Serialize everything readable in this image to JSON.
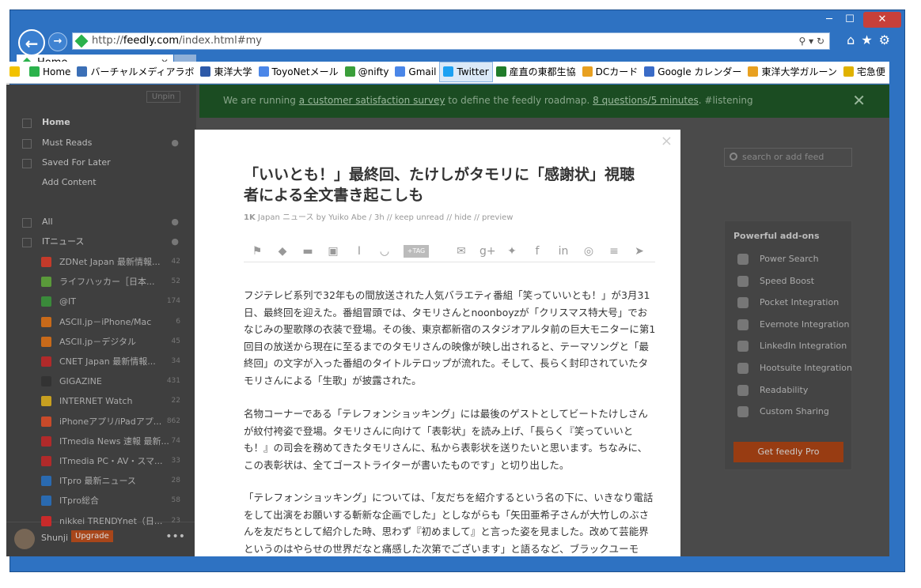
{
  "window": {
    "min": "─",
    "max": "☐",
    "close": "✕"
  },
  "nav": {
    "url_prefix": "http://",
    "url_domain": "feedly.com",
    "url_path": "/index.html#my",
    "addr_tools": "⚲ ▾ ↻",
    "toolbar_icons": "⌂★⚙"
  },
  "tab": {
    "label": "Home",
    "close": "✕"
  },
  "favorites": [
    {
      "label": "",
      "icon": "star-add-icon",
      "color": "#f2c200"
    },
    {
      "label": "Home",
      "icon": "feedly-icon",
      "color": "#2bb24c"
    },
    {
      "label": "バーチャルメディアラボ",
      "icon": "vml-icon",
      "color": "#3b6fb6"
    },
    {
      "label": "東洋大学",
      "icon": "toyo-icon",
      "color": "#2e5aa8"
    },
    {
      "label": "ToyoNetメール",
      "icon": "google-icon",
      "color": "#4a86e8"
    },
    {
      "label": "@nifty",
      "icon": "nifty-icon",
      "color": "#3a9e3a"
    },
    {
      "label": "Gmail",
      "icon": "google-icon",
      "color": "#4a86e8"
    },
    {
      "label": "Twitter",
      "icon": "twitter-icon",
      "color": "#1da1f2"
    },
    {
      "label": "産直の東都生協",
      "icon": "coop-icon",
      "color": "#207c2a"
    },
    {
      "label": "DCカード",
      "icon": "ie-icon",
      "color": "#e8a020"
    },
    {
      "label": "Google カレンダー",
      "icon": "calendar-icon",
      "color": "#3a6bc7"
    },
    {
      "label": "東洋大学ガルーン",
      "icon": "ie-icon",
      "color": "#e8a020"
    },
    {
      "label": "宅急便",
      "icon": "yamato-icon",
      "color": "#e0b200"
    }
  ],
  "sidebar": {
    "unpin": "Unpin",
    "nav": [
      {
        "label": "Home",
        "bold": true,
        "extra": ""
      },
      {
        "label": "Must Reads",
        "bold": false,
        "extra": "●"
      },
      {
        "label": "Saved For Later",
        "bold": false,
        "extra": ""
      },
      {
        "label": "Add Content",
        "bold": false,
        "extra": ""
      },
      {
        "label": "All",
        "bold": false,
        "extra": "●"
      },
      {
        "label": "ITニュース",
        "bold": false,
        "extra": "●"
      }
    ],
    "feeds": [
      {
        "label": "ZDNet Japan 最新情報...",
        "count": "42",
        "color": "#c43a2a"
      },
      {
        "label": "ライフハッカー［日本...",
        "count": "52",
        "color": "#5a9a3a"
      },
      {
        "label": "@IT",
        "count": "174",
        "color": "#3a8a3a"
      },
      {
        "label": "ASCII.jp－iPhone/Mac",
        "count": "6",
        "color": "#c86a1a"
      },
      {
        "label": "ASCII.jp－デジタル",
        "count": "45",
        "color": "#c86a1a"
      },
      {
        "label": "CNET Japan 最新情報...",
        "count": "34",
        "color": "#b02a2a"
      },
      {
        "label": "GIGAZINE",
        "count": "431",
        "color": "#333333"
      },
      {
        "label": "INTERNET Watch",
        "count": "22",
        "color": "#c8a020"
      },
      {
        "label": "iPhoneアプリ/iPadアプ...",
        "count": "862",
        "color": "#c84a2a"
      },
      {
        "label": "ITmedia News 速報 最新...",
        "count": "74",
        "color": "#b02a2a"
      },
      {
        "label": "ITmedia PC・AV・スマ...",
        "count": "33",
        "color": "#b02a2a"
      },
      {
        "label": "ITpro 最新ニュース",
        "count": "28",
        "color": "#2a6ab0"
      },
      {
        "label": "ITpro総合",
        "count": "58",
        "color": "#2a6ab0"
      },
      {
        "label": "nikkei TRENDYnet（日...",
        "count": "23",
        "color": "#c82a2a"
      }
    ],
    "user": {
      "name": "Shunji",
      "upgrade": "Upgrade",
      "more": "•••"
    }
  },
  "banner": {
    "pre": "We are running ",
    "link1": "a customer satisfaction survey",
    "mid": " to define the feedly roadmap. ",
    "link2": "8 questions/5 minutes",
    "post": ". #listening",
    "close": "✕"
  },
  "search": {
    "placeholder": "search or add feed"
  },
  "addons": {
    "header": "Powerful add-ons",
    "items": [
      {
        "label": "Power Search",
        "icon": "search-icon"
      },
      {
        "label": "Speed Boost",
        "icon": "rocket-icon"
      },
      {
        "label": "Pocket Integration",
        "icon": "pocket-icon"
      },
      {
        "label": "Evernote Integration",
        "icon": "evernote-icon"
      },
      {
        "label": "LinkedIn Integration",
        "icon": "linkedin-icon"
      },
      {
        "label": "Hootsuite Integration",
        "icon": "hootsuite-icon"
      },
      {
        "label": "Readability",
        "icon": "readability-icon"
      },
      {
        "label": "Custom Sharing",
        "icon": "send-icon"
      }
    ],
    "pro_button": "Get feedly Pro"
  },
  "article": {
    "close": "×",
    "title": "「いいとも！」最終回、たけしがタモリに「感謝状」視聴者による全文書き起こしも",
    "meta_count": "1K",
    "meta_rest": "Japan ニュース by Yuiko Abe  /  3h  //  keep unread  //  hide  //  preview",
    "share_tag": "+TAG",
    "paragraphs": [
      "フジテレビ系列で32年もの間放送された人気バラエティ番組「笑っていいとも！」が3月31日、最終回を迎えた。番組冒頭では、タモリさんとnoonboyzが「クリスマス特大号」でおなじみの聖歌隊の衣装で登場。その後、東京都新宿のスタジオアルタ前の巨大モニターに第1回目の放送から現在に至るまでのタモリさんの映像が映し出されると、テーマソングと「最終回」の文字が入った番組のタイトルテロップが流れた。そして、長らく封印されていたタモリさんによる「生歌」が披露された。",
      "名物コーナーである「テレフォンショッキング」には最後のゲストとしてビートたけしさんが紋付袴姿で登場。タモリさんに向けて「表彰状」を読み上げ、「長らく『笑っていいとも！』の司会を務めてきたタモリさんに、私から表彰状を送りたいと思います。ちなみに、この表彰状は、全てゴーストライターが書いたものです」と切り出した。",
      "「テレフォンショッキング」については、「友だちを紹介するという名の下に、いきなり電話をして出演をお願いする斬新な企画でした」としながらも「矢田亜希子さんが大竹しのぶさんを友だちとして紹介した時、思わず『初めまして』と言った姿を見ました。改めて芸能界というのはやらせの世界だなと痛感した次第でございます」と語るなど、ブラックユーモ"
    ]
  }
}
